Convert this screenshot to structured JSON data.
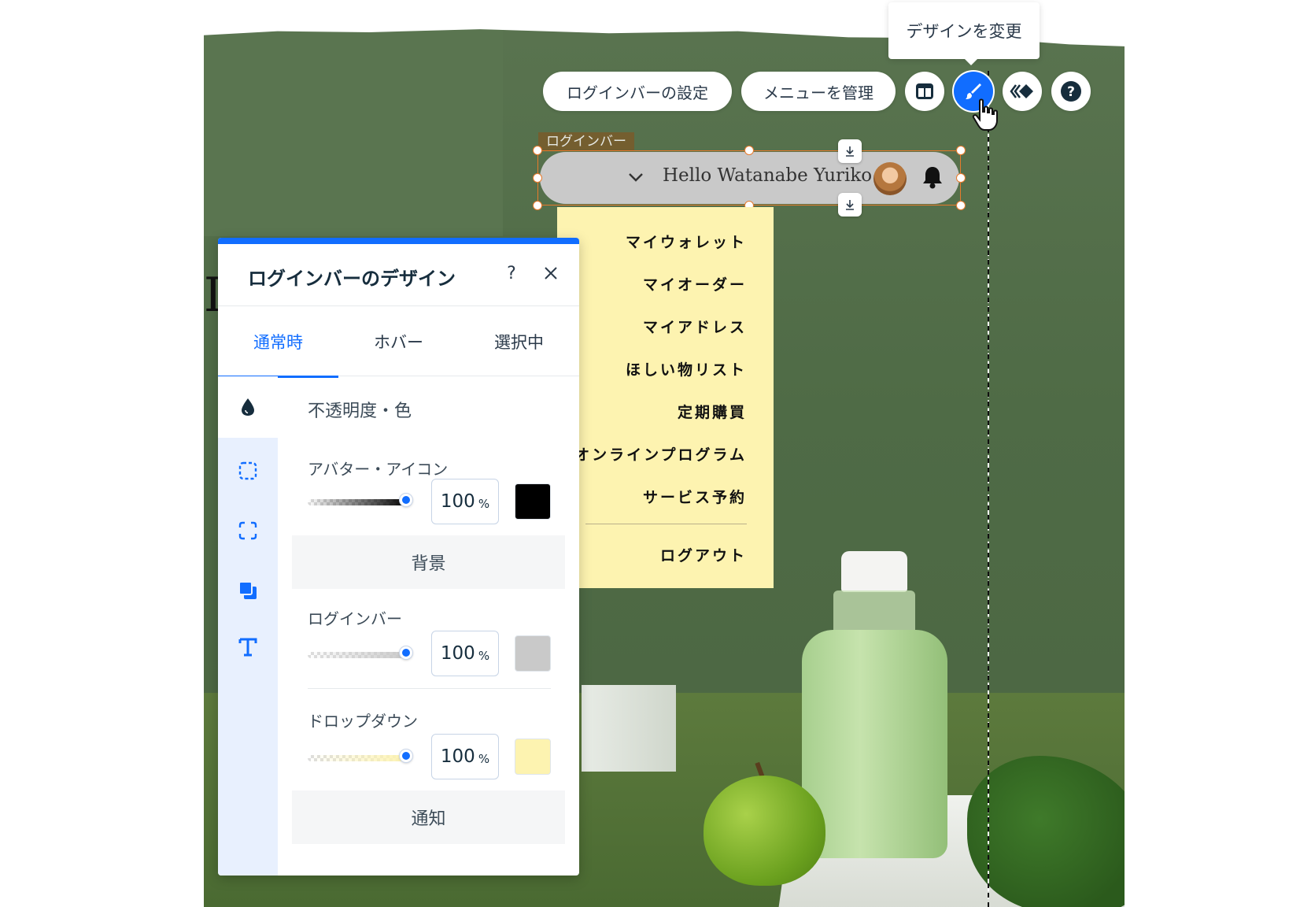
{
  "tooltip": {
    "text": "デザインを変更"
  },
  "toolbar": {
    "login_settings_label": "ログインバーの設定",
    "manage_menu_label": "メニューを管理",
    "accent_color": "#116dff"
  },
  "element": {
    "tag": "ログインバー",
    "greeting": "Hello Watanabe Yuriko"
  },
  "dropdown": {
    "items": [
      "マイウォレット",
      "マイオーダー",
      "マイアドレス",
      "ほしい物リスト",
      "定期購買",
      "オンラインプログラム",
      "サービス予約"
    ],
    "logout": "ログアウト",
    "background_color": "#fdf3b0"
  },
  "panel": {
    "title": "ログインバーのデザイン",
    "help": "?",
    "tabs": [
      "通常時",
      "ホバー",
      "選択中"
    ],
    "active_tab": "通常時",
    "sidebar_icons": [
      "fill-drop-icon",
      "border-dashed-icon",
      "corners-icon",
      "shadow-icon",
      "text-icon"
    ],
    "section_title": "不透明度・色",
    "avatar_icon": {
      "label": "アバター・アイコン",
      "opacity": "100",
      "unit": "%",
      "color": "#000000"
    },
    "background_header": "背景",
    "login_bar": {
      "label": "ログインバー",
      "opacity": "100",
      "unit": "%",
      "color": "#c9c9c9"
    },
    "dropdown": {
      "label": "ドロップダウン",
      "opacity": "100",
      "unit": "%",
      "color": "#fdf3b0"
    },
    "notification_header": "通知"
  }
}
